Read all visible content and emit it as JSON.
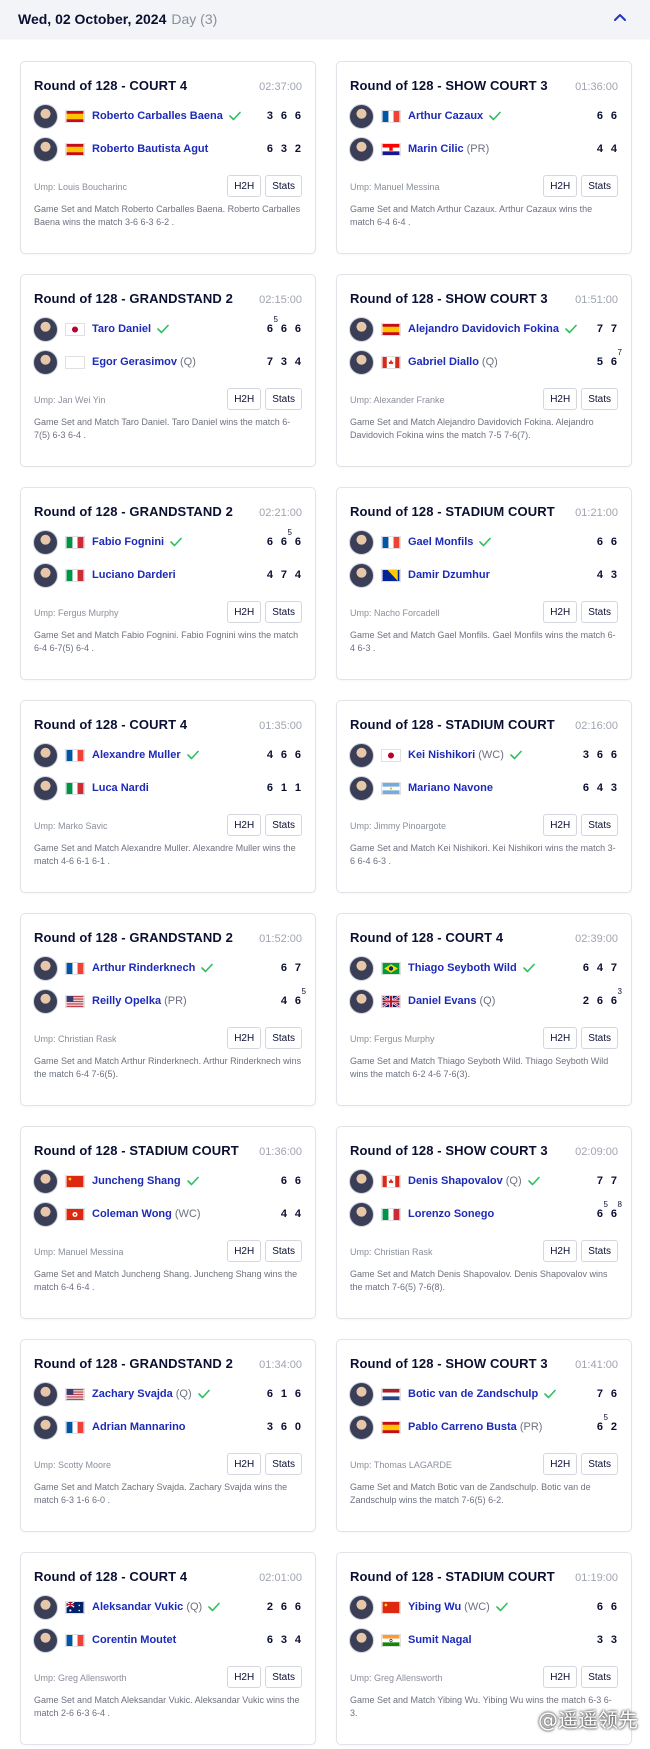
{
  "header": {
    "date": "Wed, 02 October, 2024",
    "day": "Day (3)"
  },
  "buttons": {
    "h2h": "H2H",
    "stats": "Stats"
  },
  "watermark": "@遥遥领先",
  "matches": [
    {
      "round": "Round of 128 - COURT 4",
      "duration": "02:37:00",
      "p1": {
        "name": "Roberto Carballes Baena",
        "seed": "",
        "flag": "spain",
        "winner": true,
        "scores": [
          "3",
          "6",
          "6"
        ],
        "sup": [
          "",
          "",
          ""
        ]
      },
      "p2": {
        "name": "Roberto Bautista Agut",
        "seed": "",
        "flag": "spain",
        "winner": false,
        "scores": [
          "6",
          "3",
          "2"
        ],
        "sup": [
          "",
          "",
          ""
        ]
      },
      "umpire": "Ump: Louis Boucharinc",
      "summary": "Game Set and Match Roberto Carballes Baena. Roberto Carballes Baena wins the match 3-6 6-3 6-2 ."
    },
    {
      "round": "Round of 128 - SHOW COURT 3",
      "duration": "01:36:00",
      "p1": {
        "name": "Arthur Cazaux",
        "seed": "",
        "flag": "france",
        "winner": true,
        "scores": [
          "6",
          "6"
        ],
        "sup": [
          "",
          ""
        ]
      },
      "p2": {
        "name": "Marin Cilic",
        "seed": "(PR)",
        "flag": "croatia",
        "winner": false,
        "scores": [
          "4",
          "4"
        ],
        "sup": [
          "",
          ""
        ]
      },
      "umpire": "Ump: Manuel Messina",
      "summary": "Game Set and Match Arthur Cazaux. Arthur Cazaux wins the match 6-4 6-4 ."
    },
    {
      "round": "Round of 128 - GRANDSTAND 2",
      "duration": "02:15:00",
      "p1": {
        "name": "Taro Daniel",
        "seed": "",
        "flag": "japan",
        "winner": true,
        "scores": [
          "6",
          "6",
          "6"
        ],
        "sup": [
          "5",
          "",
          ""
        ]
      },
      "p2": {
        "name": "Egor Gerasimov",
        "seed": "(Q)",
        "flag": "blank",
        "winner": false,
        "scores": [
          "7",
          "3",
          "4"
        ],
        "sup": [
          "",
          "",
          ""
        ]
      },
      "umpire": "Ump: Jan Wei Yin",
      "summary": "Game Set and Match Taro Daniel. Taro Daniel wins the match 6-7(5) 6-3 6-4 ."
    },
    {
      "round": "Round of 128 - SHOW COURT 3",
      "duration": "01:51:00",
      "p1": {
        "name": "Alejandro Davidovich Fokina",
        "seed": "",
        "flag": "spain",
        "winner": true,
        "scores": [
          "7",
          "7"
        ],
        "sup": [
          "",
          ""
        ]
      },
      "p2": {
        "name": "Gabriel Diallo",
        "seed": "(Q)",
        "flag": "canada",
        "winner": false,
        "scores": [
          "5",
          "6"
        ],
        "sup": [
          "",
          "7"
        ]
      },
      "umpire": "Ump: Alexander Franke",
      "summary": "Game Set and Match Alejandro Davidovich Fokina. Alejandro Davidovich Fokina wins the match 7-5 7-6(7)."
    },
    {
      "round": "Round of 128 - GRANDSTAND 2",
      "duration": "02:21:00",
      "p1": {
        "name": "Fabio Fognini",
        "seed": "",
        "flag": "italy",
        "winner": true,
        "scores": [
          "6",
          "6",
          "6"
        ],
        "sup": [
          "",
          "5",
          ""
        ]
      },
      "p2": {
        "name": "Luciano Darderi",
        "seed": "",
        "flag": "italy",
        "winner": false,
        "scores": [
          "4",
          "7",
          "4"
        ],
        "sup": [
          "",
          "",
          ""
        ]
      },
      "umpire": "Ump: Fergus Murphy",
      "summary": "Game Set and Match Fabio Fognini. Fabio Fognini wins the match 6-4 6-7(5) 6-4 ."
    },
    {
      "round": "Round of 128 - STADIUM COURT",
      "duration": "01:21:00",
      "p1": {
        "name": "Gael Monfils",
        "seed": "",
        "flag": "france",
        "winner": true,
        "scores": [
          "6",
          "6"
        ],
        "sup": [
          "",
          ""
        ]
      },
      "p2": {
        "name": "Damir Dzumhur",
        "seed": "",
        "flag": "bosnia",
        "winner": false,
        "scores": [
          "4",
          "3"
        ],
        "sup": [
          "",
          ""
        ]
      },
      "umpire": "Ump: Nacho Forcadell",
      "summary": "Game Set and Match Gael Monfils. Gael Monfils wins the match 6-4 6-3 ."
    },
    {
      "round": "Round of 128 - COURT 4",
      "duration": "01:35:00",
      "p1": {
        "name": "Alexandre Muller",
        "seed": "",
        "flag": "france",
        "winner": true,
        "scores": [
          "4",
          "6",
          "6"
        ],
        "sup": [
          "",
          "",
          ""
        ]
      },
      "p2": {
        "name": "Luca Nardi",
        "seed": "",
        "flag": "italy",
        "winner": false,
        "scores": [
          "6",
          "1",
          "1"
        ],
        "sup": [
          "",
          "",
          ""
        ]
      },
      "umpire": "Ump: Marko Savic",
      "summary": "Game Set and Match Alexandre Muller. Alexandre Muller wins the match 4-6 6-1 6-1 ."
    },
    {
      "round": "Round of 128 - STADIUM COURT",
      "duration": "02:16:00",
      "p1": {
        "name": "Kei Nishikori",
        "seed": "(WC)",
        "flag": "japan",
        "winner": true,
        "scores": [
          "3",
          "6",
          "6"
        ],
        "sup": [
          "",
          "",
          ""
        ]
      },
      "p2": {
        "name": "Mariano Navone",
        "seed": "",
        "flag": "argentina",
        "winner": false,
        "scores": [
          "6",
          "4",
          "3"
        ],
        "sup": [
          "",
          "",
          ""
        ]
      },
      "umpire": "Ump: Jimmy Pinoargote",
      "summary": "Game Set and Match Kei Nishikori. Kei Nishikori wins the match 3-6 6-4 6-3 ."
    },
    {
      "round": "Round of 128 - GRANDSTAND 2",
      "duration": "01:52:00",
      "p1": {
        "name": "Arthur Rinderknech",
        "seed": "",
        "flag": "france",
        "winner": true,
        "scores": [
          "6",
          "7"
        ],
        "sup": [
          "",
          ""
        ]
      },
      "p2": {
        "name": "Reilly Opelka",
        "seed": "(PR)",
        "flag": "usa",
        "winner": false,
        "scores": [
          "4",
          "6"
        ],
        "sup": [
          "",
          "5"
        ]
      },
      "umpire": "Ump: Christian Rask",
      "summary": "Game Set and Match Arthur Rinderknech. Arthur Rinderknech wins the match 6-4 7-6(5)."
    },
    {
      "round": "Round of 128 - COURT 4",
      "duration": "02:39:00",
      "p1": {
        "name": "Thiago Seyboth Wild",
        "seed": "",
        "flag": "brazil",
        "winner": true,
        "scores": [
          "6",
          "4",
          "7"
        ],
        "sup": [
          "",
          "",
          ""
        ]
      },
      "p2": {
        "name": "Daniel Evans",
        "seed": "(Q)",
        "flag": "uk",
        "winner": false,
        "scores": [
          "2",
          "6",
          "6"
        ],
        "sup": [
          "",
          "",
          "3"
        ]
      },
      "umpire": "Ump: Fergus Murphy",
      "summary": "Game Set and Match Thiago Seyboth Wild. Thiago Seyboth Wild wins the match 6-2 4-6 7-6(3)."
    },
    {
      "round": "Round of 128 - STADIUM COURT",
      "duration": "01:36:00",
      "p1": {
        "name": "Juncheng Shang",
        "seed": "",
        "flag": "china",
        "winner": true,
        "scores": [
          "6",
          "6"
        ],
        "sup": [
          "",
          ""
        ]
      },
      "p2": {
        "name": "Coleman Wong",
        "seed": "(WC)",
        "flag": "hongkong",
        "winner": false,
        "scores": [
          "4",
          "4"
        ],
        "sup": [
          "",
          ""
        ]
      },
      "umpire": "Ump: Manuel Messina",
      "summary": "Game Set and Match Juncheng Shang. Juncheng Shang wins the match 6-4 6-4 ."
    },
    {
      "round": "Round of 128 - SHOW COURT 3",
      "duration": "02:09:00",
      "p1": {
        "name": "Denis Shapovalov",
        "seed": "(Q)",
        "flag": "canada",
        "winner": true,
        "scores": [
          "7",
          "7"
        ],
        "sup": [
          "",
          ""
        ]
      },
      "p2": {
        "name": "Lorenzo Sonego",
        "seed": "",
        "flag": "italy",
        "winner": false,
        "scores": [
          "6",
          "6"
        ],
        "sup": [
          "5",
          "8"
        ]
      },
      "umpire": "Ump: Christian Rask",
      "summary": "Game Set and Match Denis Shapovalov. Denis Shapovalov wins the match 7-6(5) 7-6(8)."
    },
    {
      "round": "Round of 128 - GRANDSTAND 2",
      "duration": "01:34:00",
      "p1": {
        "name": "Zachary Svajda",
        "seed": "(Q)",
        "flag": "usa",
        "winner": true,
        "scores": [
          "6",
          "1",
          "6"
        ],
        "sup": [
          "",
          "",
          ""
        ]
      },
      "p2": {
        "name": "Adrian Mannarino",
        "seed": "",
        "flag": "france",
        "winner": false,
        "scores": [
          "3",
          "6",
          "0"
        ],
        "sup": [
          "",
          "",
          ""
        ]
      },
      "umpire": "Ump: Scotty Moore",
      "summary": "Game Set and Match Zachary Svajda. Zachary Svajda wins the match 6-3 1-6 6-0 ."
    },
    {
      "round": "Round of 128 - SHOW COURT 3",
      "duration": "01:41:00",
      "p1": {
        "name": "Botic van de Zandschulp",
        "seed": "",
        "flag": "netherlands",
        "winner": true,
        "scores": [
          "7",
          "6"
        ],
        "sup": [
          "",
          ""
        ]
      },
      "p2": {
        "name": "Pablo Carreno Busta",
        "seed": "(PR)",
        "flag": "spain",
        "winner": false,
        "scores": [
          "6",
          "2"
        ],
        "sup": [
          "5",
          ""
        ]
      },
      "umpire": "Ump: Thomas LAGARDE",
      "summary": "Game Set and Match Botic van de Zandschulp. Botic van de Zandschulp wins the match 7-6(5) 6-2."
    },
    {
      "round": "Round of 128 - COURT 4",
      "duration": "02:01:00",
      "p1": {
        "name": "Aleksandar Vukic",
        "seed": "(Q)",
        "flag": "australia",
        "winner": true,
        "scores": [
          "2",
          "6",
          "6"
        ],
        "sup": [
          "",
          "",
          ""
        ]
      },
      "p2": {
        "name": "Corentin Moutet",
        "seed": "",
        "flag": "france",
        "winner": false,
        "scores": [
          "6",
          "3",
          "4"
        ],
        "sup": [
          "",
          "",
          ""
        ]
      },
      "umpire": "Ump: Greg Allensworth",
      "summary": "Game Set and Match Aleksandar Vukic. Aleksandar Vukic wins the match 2-6 6-3 6-4 ."
    },
    {
      "round": "Round of 128 - STADIUM COURT",
      "duration": "01:19:00",
      "p1": {
        "name": "Yibing Wu",
        "seed": "(WC)",
        "flag": "china",
        "winner": true,
        "scores": [
          "6",
          "6"
        ],
        "sup": [
          "",
          ""
        ]
      },
      "p2": {
        "name": "Sumit Nagal",
        "seed": "",
        "flag": "india",
        "winner": false,
        "scores": [
          "3",
          "3"
        ],
        "sup": [
          "",
          ""
        ]
      },
      "umpire": "Ump: Greg Allensworth",
      "summary": "Game Set and Match Yibing Wu. Yibing Wu wins the match 6-3 6-3."
    }
  ]
}
